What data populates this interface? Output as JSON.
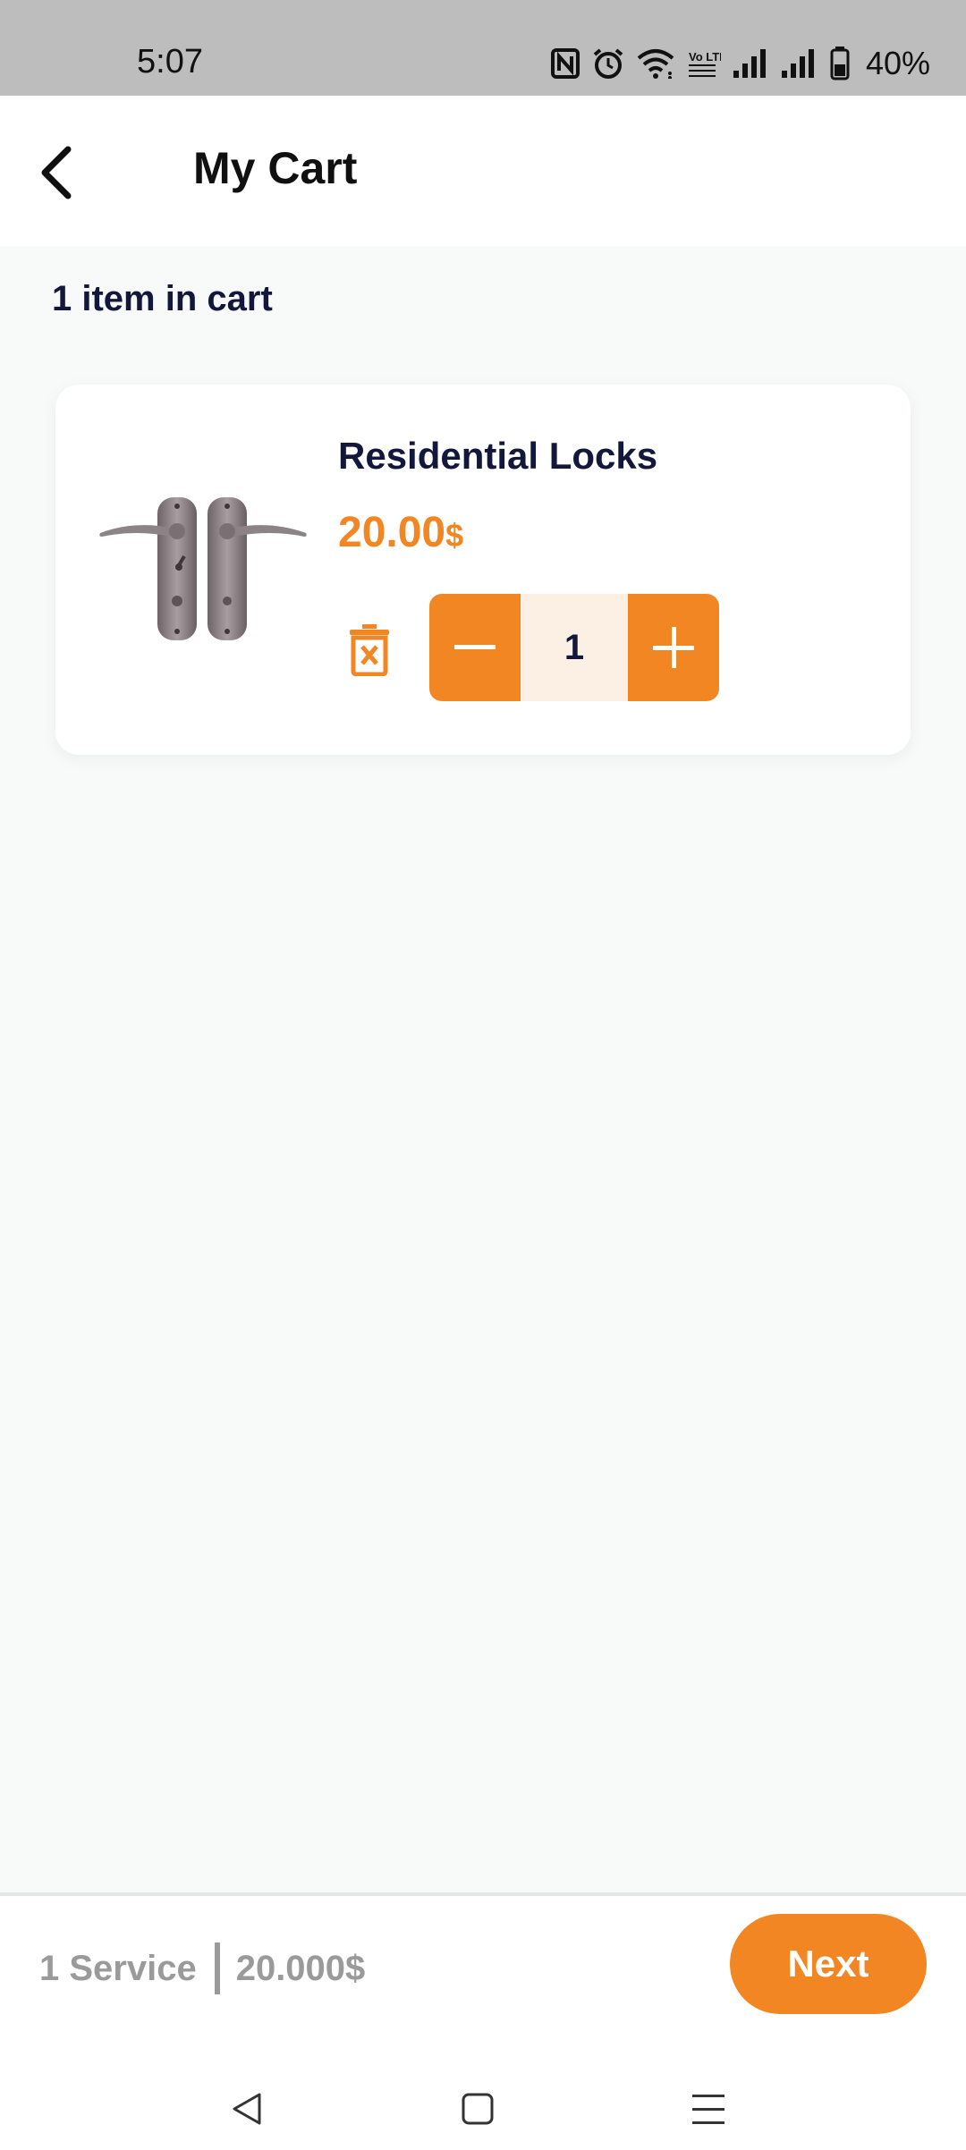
{
  "status_bar": {
    "time": "5:07",
    "battery_percent": "40%",
    "volte_label": "Vo LTE",
    "icons": [
      "nfc-icon",
      "alarm-icon",
      "wifi-icon",
      "volte-icon",
      "signal-icon",
      "signal-icon",
      "battery-icon"
    ]
  },
  "header": {
    "title": "My Cart",
    "back_icon": "chevron-left-icon"
  },
  "cart": {
    "count_text": "1 item in cart",
    "items": [
      {
        "name": "Residential Locks",
        "price": "20.00",
        "currency": "$",
        "quantity": "1",
        "image": "door-lock-handle-image"
      }
    ]
  },
  "summary": {
    "services": "1 Service",
    "total": "20.000$",
    "next_label": "Next"
  },
  "nav": {
    "back_icon": "triangle-back-icon",
    "home_icon": "square-home-icon",
    "menu_icon": "hamburger-menu-icon"
  },
  "colors": {
    "accent": "#f28623",
    "accent_light": "#fcefe4",
    "text_dark": "#13173b",
    "muted": "#9a9a9a",
    "background": "#f8f9f9",
    "status_bar": "#bdbdbd"
  }
}
